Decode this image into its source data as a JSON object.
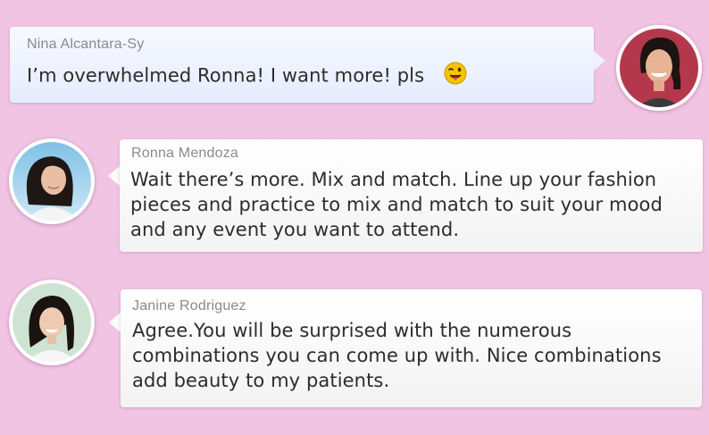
{
  "messages": [
    {
      "sender": "Nina Alcantara-Sy",
      "text": "I’m overwhelmed Ronna! I want more!  pls",
      "emoji": "tongue-out-winking-emoji"
    },
    {
      "sender": "Ronna Mendoza",
      "lines": [
        "Wait there’s more.  Mix and match. Line up your fashion",
        "pieces and practice to mix and match to suit your mood",
        "and any event you want to attend."
      ]
    },
    {
      "sender": "Janine Rodriguez",
      "lines": [
        "Agree.You will be surprised with the numerous",
        "combinations you can come up with. Nice combinations",
        "add beauty to my patients."
      ]
    }
  ],
  "colors": {
    "background": "#f1c4e3",
    "outgoing_bubble": "#e9effd",
    "incoming_bubble": "#f7f7f7",
    "sender_name": "#8a8a8a",
    "message_text": "#2c2c2c"
  }
}
